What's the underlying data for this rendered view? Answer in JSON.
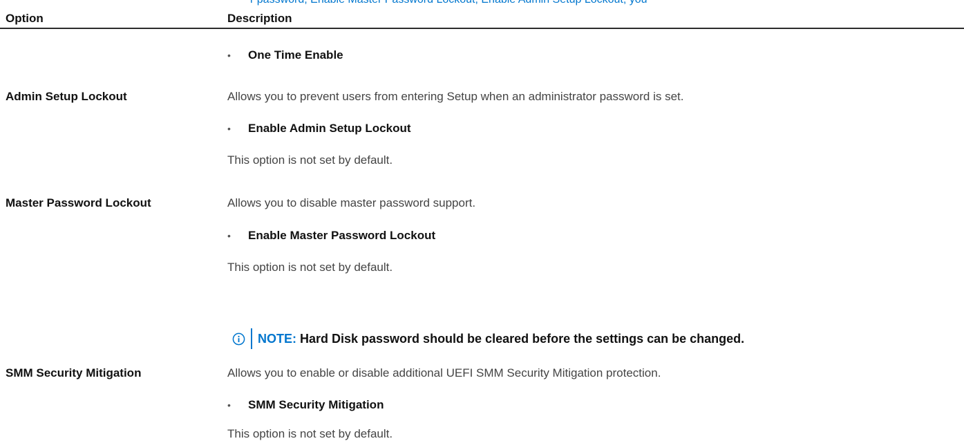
{
  "clipped_heading": "r password, Enable Master Password Lockout, Enable Admin Setup Lockout, you",
  "table": {
    "header_option": "Option",
    "header_description": "Description",
    "rows": [
      {
        "option": "",
        "bullet": "One Time Enable"
      },
      {
        "option": "Admin Setup Lockout",
        "description": "Allows you to prevent users from entering Setup when an administrator password is set.",
        "bullet": "Enable Admin Setup Lockout",
        "default_text": "This option is not set by default."
      },
      {
        "option": "Master Password Lockout",
        "description": "Allows you to disable master password support.",
        "bullet": "Enable Master Password Lockout",
        "default_text": "This option is not set by default.",
        "note": {
          "icon": "info-circle-icon",
          "label": "NOTE:",
          "text": "Hard Disk password should be cleared before the settings can be changed."
        }
      },
      {
        "option": "SMM Security Mitigation",
        "description": "Allows you to enable or disable additional UEFI SMM Security Mitigation protection.",
        "bullet": "SMM Security Mitigation",
        "default_text": "This option is not set by default."
      }
    ]
  },
  "colors": {
    "accent": "#0076ce",
    "text": "#444444",
    "heading": "#111111"
  }
}
